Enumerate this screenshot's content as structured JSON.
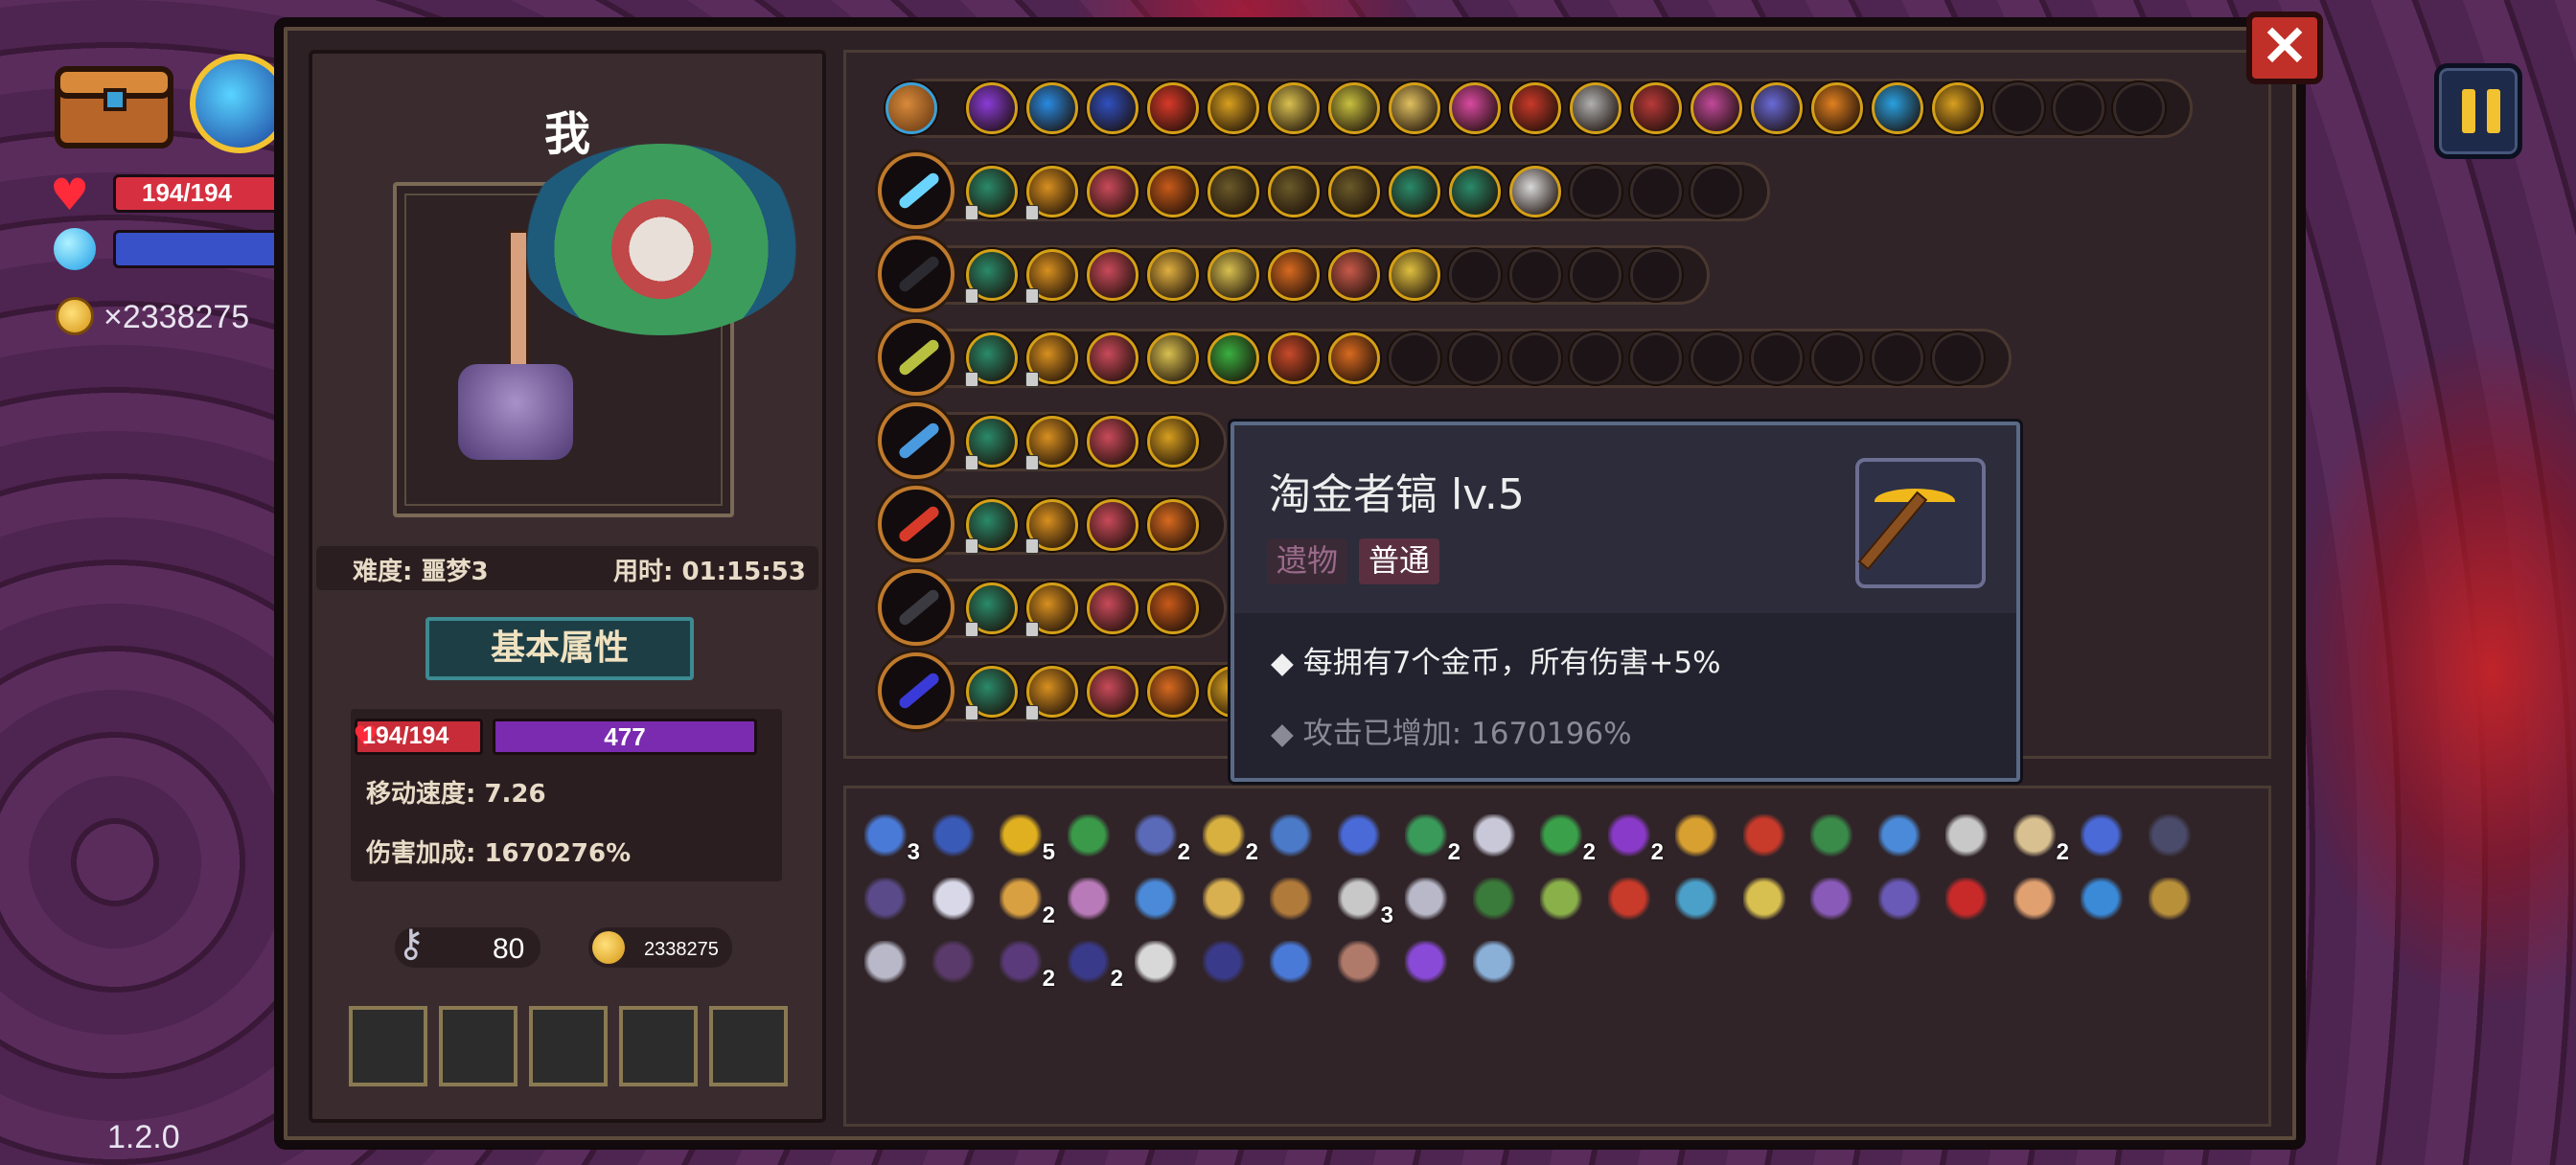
{
  "hud": {
    "hp": "194/194",
    "gold": "×2338275",
    "version": "1.2.0"
  },
  "player": {
    "name": "我",
    "difficulty": "难度: 噩梦3",
    "time": "用时: 01:15:53",
    "attr_button": "基本属性",
    "hp": "194/194",
    "xp": "477",
    "move_speed": "移动速度: 7.26",
    "damage_bonus": "伤害加成: 1670276%",
    "keys": "80",
    "coins": "2338275",
    "slots": 5
  },
  "tooltip": {
    "title": "淘金者镐 lv.5",
    "tag_type": "遗物",
    "tag_rarity": "普通",
    "description": "每拥有7个金币，所有伤害+5%",
    "note": "攻击已增加: 1670196%"
  },
  "colors": {
    "accent_gold": "#d4a016",
    "panel_bg": "#2d2126",
    "hp_red": "#c82c38",
    "xp_purple": "#7a2bb0",
    "tooltip_border": "#5a6a86"
  },
  "close_icon": "close-icon",
  "pause_icon": "pause-icon",
  "top_row_icons": [
    "#8a3cd8",
    "#2a8ae0",
    "#3050c0",
    "#d83a2a",
    "#d8a020",
    "#d8c050",
    "#c8c040",
    "#e0c060",
    "#d84aa0",
    "#c83a2a",
    "#b0b0b0",
    "#b83a3a",
    "#c04a9a",
    "#6a6ad8",
    "#e08020",
    "#2aa0e0",
    "#d8a020",
    "",
    "",
    ""
  ],
  "weapons": [
    {
      "name": "sword",
      "color": "#6ad4ff",
      "icons": [
        "#2a8a6a",
        "#d89020",
        "#c84a5a",
        "#c85a1a",
        "#6a5a2a",
        "#6a5a2a",
        "#6a5a2a",
        "#2a8a6a",
        "#2a8a6a",
        "#d8d8d8",
        "",
        "",
        ""
      ]
    },
    {
      "name": "mace",
      "color": "#2a2a30",
      "icons": [
        "#2a8a6a",
        "#d89020",
        "#c84a5a",
        "#e0b040",
        "#d8c050",
        "#d86a20",
        "#c85a4a",
        "#e0c040",
        "",
        "",
        "",
        ""
      ]
    },
    {
      "name": "scepter",
      "color": "#b8c040",
      "icons": [
        "#2a8a6a",
        "#d89020",
        "#c84a5a",
        "#d8c050",
        "#3ab040",
        "#c84a2a",
        "#d86a20",
        "",
        "",
        "",
        "",
        "",
        "",
        "",
        "",
        "",
        ""
      ]
    },
    {
      "name": "orb",
      "color": "#4a9ae0",
      "icons": [
        "#2a8a6a",
        "#d89020",
        "#c84a5a",
        "#d8a020"
      ]
    },
    {
      "name": "wand",
      "color": "#d83a2a",
      "icons": [
        "#2a8a6a",
        "#d89020",
        "#c84a5a",
        "#d86a20"
      ]
    },
    {
      "name": "spear",
      "color": "#3a3a40",
      "icons": [
        "#2a8a6a",
        "#d89020",
        "#c84a5a",
        "#c85a1a"
      ]
    },
    {
      "name": "vortex",
      "color": "#3a3ad8",
      "icons": [
        "#2a8a6a",
        "#d89020",
        "#c84a5a",
        "#d86a20",
        "#d8a020"
      ]
    }
  ],
  "items": [
    [
      [
        "#4a7ad8",
        "3"
      ],
      [
        "#3a5ab8",
        ""
      ],
      [
        "#e0b020",
        "5"
      ],
      [
        "#3a9a4a",
        ""
      ],
      [
        "#5a6ab8",
        "2"
      ],
      [
        "#d8b040",
        "2"
      ],
      [
        "#4a7ac8",
        ""
      ],
      [
        "#4a6ad8",
        ""
      ],
      [
        "#3a9a5a",
        "2"
      ],
      [
        "#c8c8d8",
        ""
      ],
      [
        "#3aa04a",
        "2"
      ],
      [
        "#8a3ac8",
        "2"
      ],
      [
        "#d8a030",
        ""
      ],
      [
        "#c83a2a",
        ""
      ],
      [
        "#3a8a4a",
        ""
      ],
      [
        "#4a8ad8",
        ""
      ],
      [
        "#c8c8c8",
        ""
      ],
      [
        "#d8c090",
        "2"
      ],
      [
        "#4a6ad8",
        ""
      ],
      [
        "#4a4a6a",
        ""
      ]
    ],
    [
      [
        "#5a4a8a",
        ""
      ],
      [
        "#d8d8e8",
        ""
      ],
      [
        "#d8a040",
        "2"
      ],
      [
        "#b87ab8",
        ""
      ],
      [
        "#4a8ad8",
        ""
      ],
      [
        "#d8b050",
        ""
      ],
      [
        "#b07a3a",
        ""
      ],
      [
        "#c8c8c8",
        "3"
      ],
      [
        "#b8b8c8",
        ""
      ],
      [
        "#3a7a3a",
        ""
      ],
      [
        "#8ab04a",
        ""
      ],
      [
        "#c83a2a",
        ""
      ],
      [
        "#4aa0c8",
        ""
      ],
      [
        "#d8c050",
        ""
      ],
      [
        "#8a5ab8",
        ""
      ],
      [
        "#6a5ab8",
        ""
      ],
      [
        "#c82a2a",
        ""
      ],
      [
        "#e0a070",
        ""
      ],
      [
        "#3a8ad8",
        ""
      ],
      [
        "#b8903a",
        ""
      ]
    ],
    [
      [
        "#b8b8c8",
        ""
      ],
      [
        "#5a3a6a",
        ""
      ],
      [
        "#5a3a7a",
        "2"
      ],
      [
        "#3a3a8a",
        "2"
      ],
      [
        "#d8d8d8",
        ""
      ],
      [
        "#3a3a8a",
        ""
      ],
      [
        "#4a7ad8",
        ""
      ],
      [
        "#b07a6a",
        ""
      ],
      [
        "#8a4ad8",
        ""
      ],
      [
        "#8ab0d8",
        ""
      ]
    ]
  ]
}
